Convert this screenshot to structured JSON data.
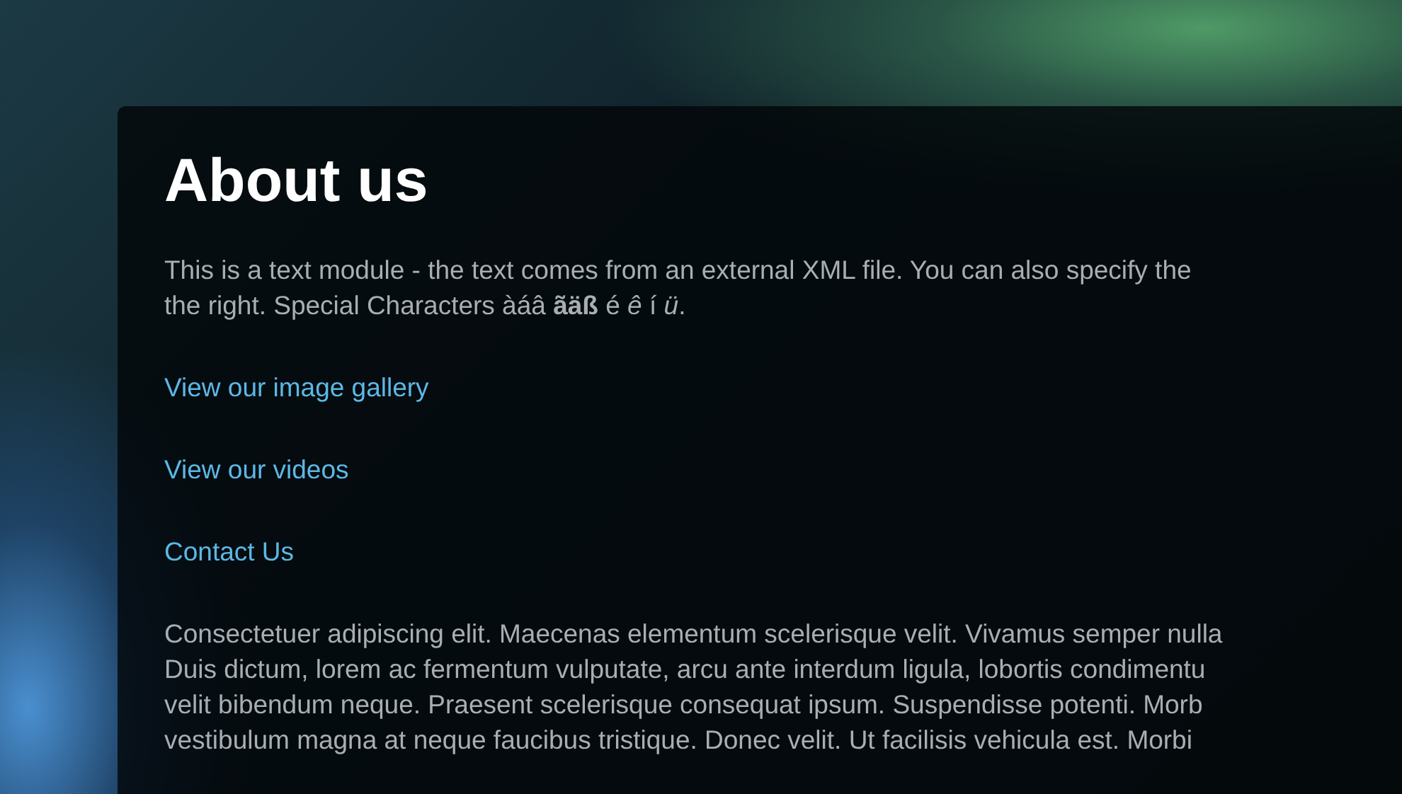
{
  "panel": {
    "title": "About us",
    "intro": [
      "This is a text module - the text comes from an external XML file. You can also specify the",
      "the right. Special Characters àáâ **ãäß** é *ê* í *ü*."
    ],
    "links": [
      "View our image gallery",
      "View our videos",
      "Contact Us"
    ],
    "body": [
      "Consectetuer adipiscing elit. Maecenas elementum scelerisque velit. Vivamus semper nulla",
      "Duis dictum, lorem ac fermentum vulputate, arcu ante interdum ligula, lobortis condimentu",
      "velit bibendum neque. Praesent scelerisque consequat ipsum. Suspendisse potenti. Morb",
      "vestibulum magna at neque faucibus tristique. Donec velit. Ut facilisis vehicula est. Morbi"
    ]
  }
}
